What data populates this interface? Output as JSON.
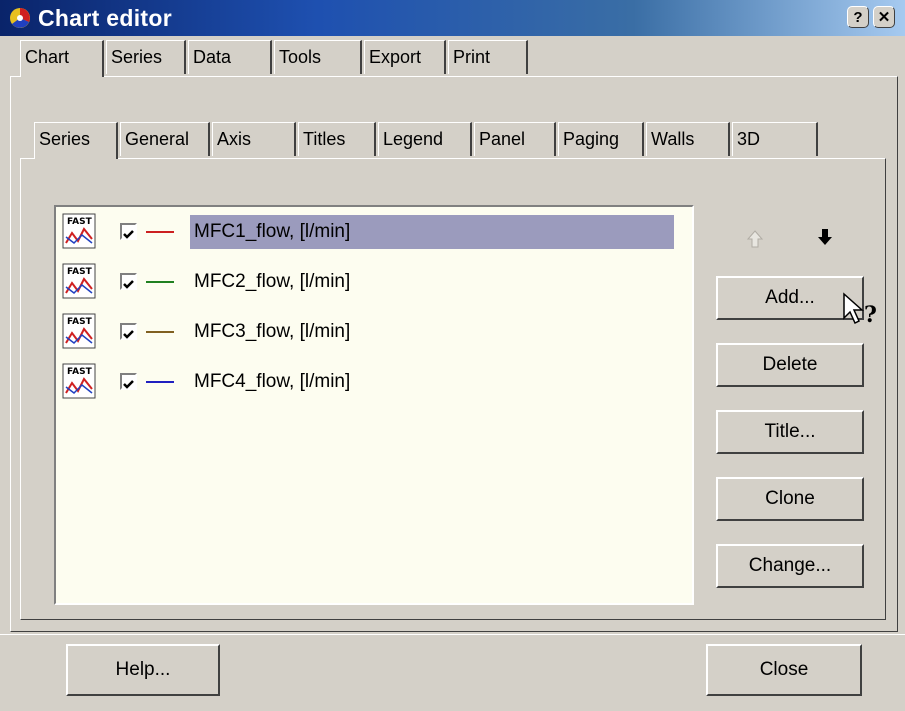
{
  "window": {
    "title": "Chart editor",
    "help_icon": "question-icon",
    "close_icon": "close-icon"
  },
  "main_tabs": [
    {
      "label": "Chart",
      "active": true
    },
    {
      "label": "Series"
    },
    {
      "label": "Data"
    },
    {
      "label": "Tools"
    },
    {
      "label": "Export"
    },
    {
      "label": "Print"
    }
  ],
  "sub_tabs": [
    {
      "label": "Series",
      "active": true
    },
    {
      "label": "General"
    },
    {
      "label": "Axis"
    },
    {
      "label": "Titles"
    },
    {
      "label": "Legend"
    },
    {
      "label": "Panel"
    },
    {
      "label": "Paging"
    },
    {
      "label": "Walls"
    },
    {
      "label": "3D"
    }
  ],
  "series_list": [
    {
      "name": "MFC1_flow, [l/min]",
      "checked": true,
      "color": "#cc2020",
      "selected": true,
      "icon": "fast-line-icon"
    },
    {
      "name": "MFC2_flow, [l/min]",
      "checked": true,
      "color": "#208020",
      "icon": "fast-line-icon"
    },
    {
      "name": "MFC3_flow, [l/min]",
      "checked": true,
      "color": "#806020",
      "icon": "fast-line-icon"
    },
    {
      "name": "MFC4_flow, [l/min]",
      "checked": true,
      "color": "#2020c0",
      "icon": "fast-line-icon"
    }
  ],
  "buttons": {
    "add": "Add...",
    "delete": "Delete",
    "title": "Title...",
    "clone": "Clone",
    "change": "Change...",
    "move_up_icon": "arrow-up-icon",
    "move_down_icon": "arrow-down-icon"
  },
  "footer": {
    "help": "Help...",
    "close": "Close"
  }
}
